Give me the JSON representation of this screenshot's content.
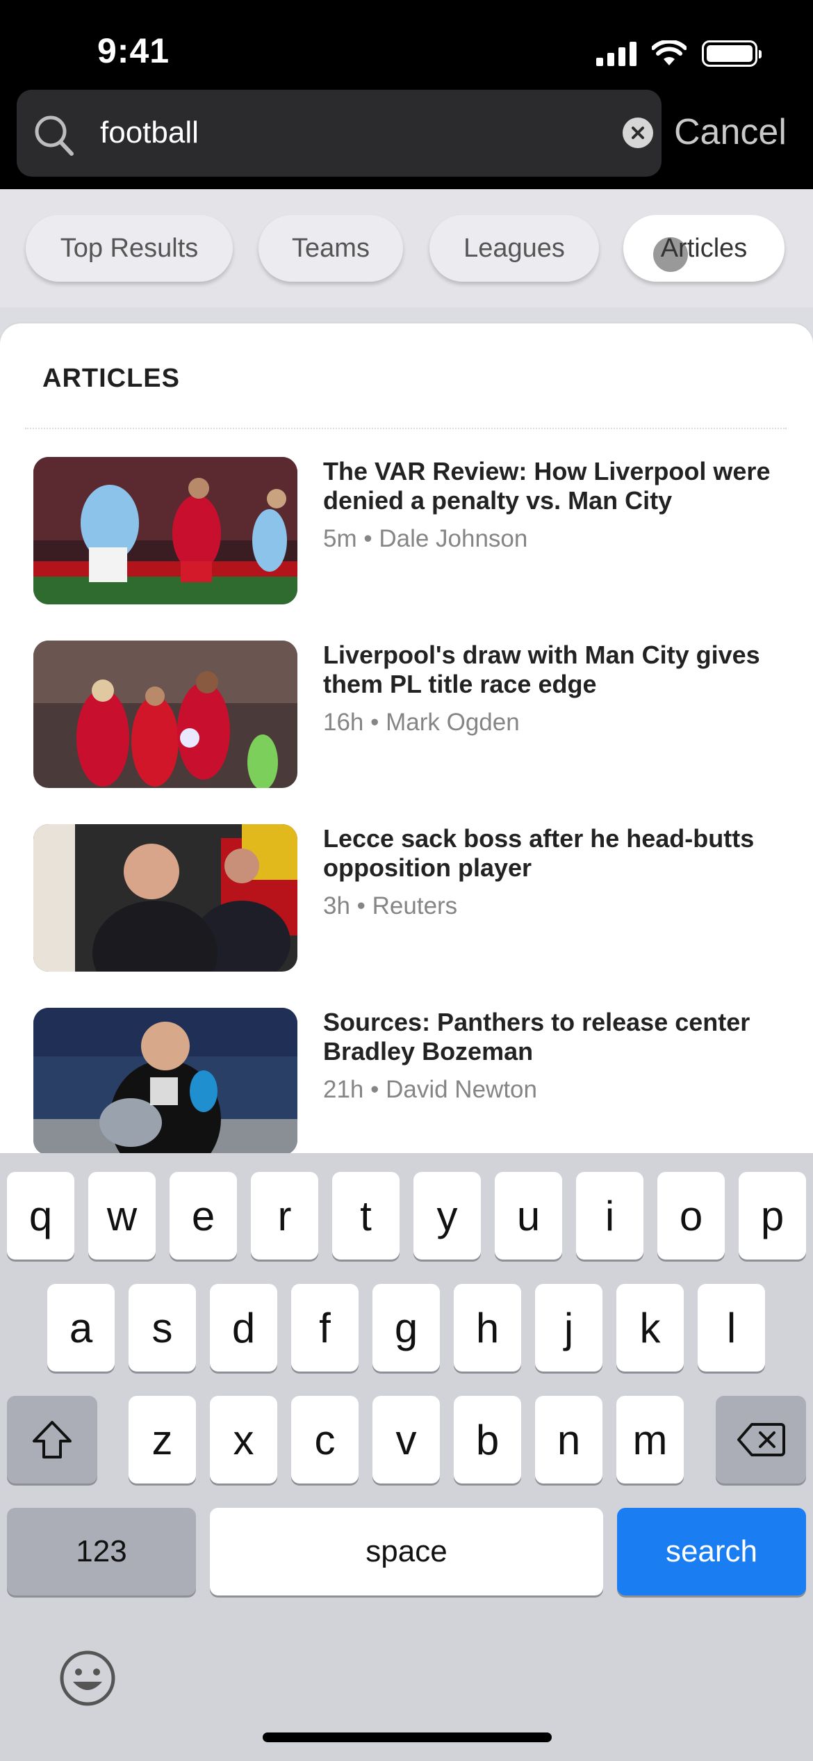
{
  "status_bar": {
    "time": "9:41"
  },
  "search": {
    "value": "football",
    "cancel_label": "Cancel"
  },
  "chips": [
    "Top Results",
    "Teams",
    "Leagues",
    "Articles"
  ],
  "active_chip": "Articles",
  "section_title": "ARTICLES",
  "articles": [
    {
      "headline": "The VAR Review: How Liverpool were denied a penalty vs. Man City",
      "meta": "5m • Dale Johnson",
      "image": "sports-photo-var-review"
    },
    {
      "headline": "Liverpool's draw with Man City gives them PL title race edge",
      "meta": "16h • Mark Ogden",
      "image": "sports-photo-liverpool-celebration"
    },
    {
      "headline": "Lecce sack boss after he head-butts opposition player",
      "meta": "3h • Reuters",
      "image": "sports-photo-lecce-coach"
    },
    {
      "headline": "Sources: Panthers to release center Bradley Bozeman",
      "meta": "21h • David Newton",
      "image": "sports-photo-panthers-player"
    }
  ],
  "keyboard": {
    "row1": [
      "q",
      "w",
      "e",
      "r",
      "t",
      "y",
      "u",
      "i",
      "o",
      "p"
    ],
    "row2": [
      "a",
      "s",
      "d",
      "f",
      "g",
      "h",
      "j",
      "k",
      "l"
    ],
    "row3": [
      "z",
      "x",
      "c",
      "v",
      "b",
      "n",
      "m"
    ],
    "numbers_label": "123",
    "space_label": "space",
    "search_label": "search",
    "shift_icon": "shift-icon",
    "delete_icon": "delete-icon",
    "emoji_icon": "emoji-icon"
  },
  "colors": {
    "accent": "#1a7df1",
    "liverpool_red": "#c8102e",
    "city_blue": "#6cabdd"
  }
}
